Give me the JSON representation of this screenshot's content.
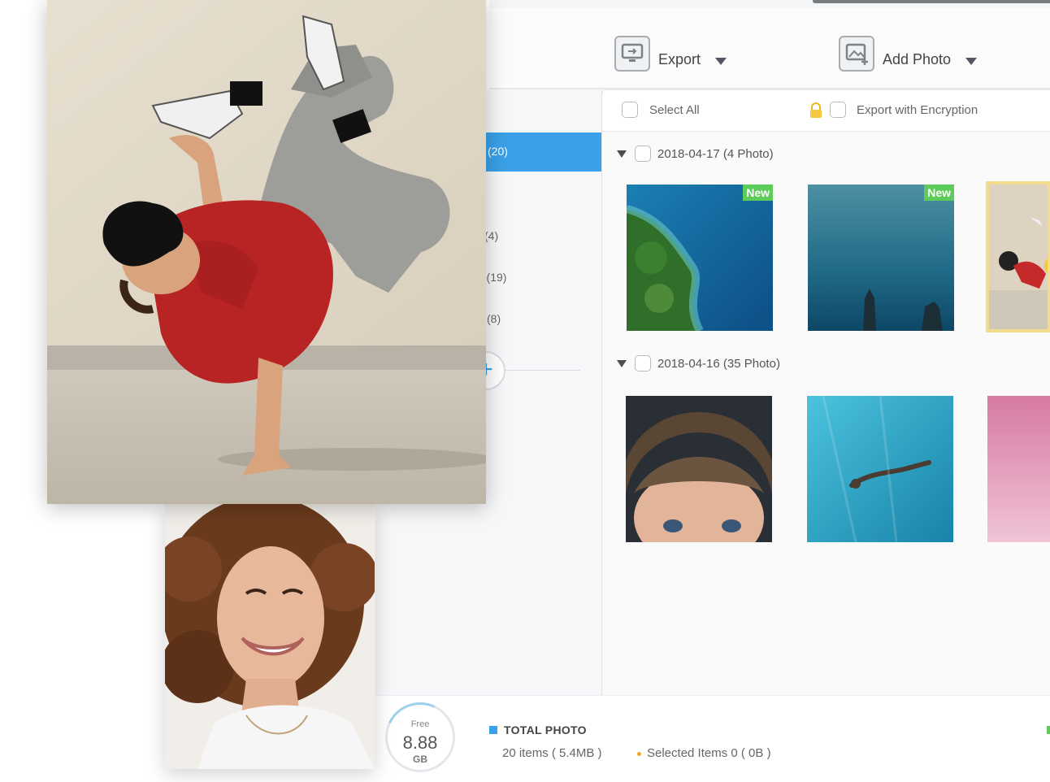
{
  "toolbar": {
    "export_label": "Export",
    "export_icon": "monitor-export-icon",
    "add_photo_label": "Add Photo",
    "add_photo_icon": "add-photo-icon"
  },
  "sidebar": {
    "active_count": "(20)",
    "items": [
      {
        "label": "(4)"
      },
      {
        "label": "r (19)"
      },
      {
        "label": "l (8)"
      }
    ],
    "add_icon": "plus-icon"
  },
  "select_bar": {
    "select_all_label": "Select All",
    "export_encryption_label": "Export with Encryption",
    "lock_icon": "lock-icon"
  },
  "groups": [
    {
      "label": "2018-04-17 (4 Photo)",
      "photos": [
        {
          "name": "coast-aerial",
          "badge": "New"
        },
        {
          "name": "ocean-rocks",
          "badge": "New"
        },
        {
          "name": "dancer-selected",
          "badge": ""
        }
      ]
    },
    {
      "label": "2018-04-16 (35 Photo)",
      "photos": [
        {
          "name": "child-hair",
          "badge": ""
        },
        {
          "name": "swimmer-underwater",
          "badge": ""
        },
        {
          "name": "pink-abstract",
          "badge": ""
        }
      ]
    }
  ],
  "footer": {
    "free_label": "Free",
    "free_value": "8.88",
    "free_unit": "GB",
    "total_title": "TOTAL PHOTO",
    "items_text": "20 items ( 5.4MB )",
    "selected_text": "Selected Items 0 ( 0B )"
  },
  "colors": {
    "accent": "#3aa0e8",
    "new_badge": "#5ccb5a",
    "selected_border": "#f5dc8a"
  }
}
